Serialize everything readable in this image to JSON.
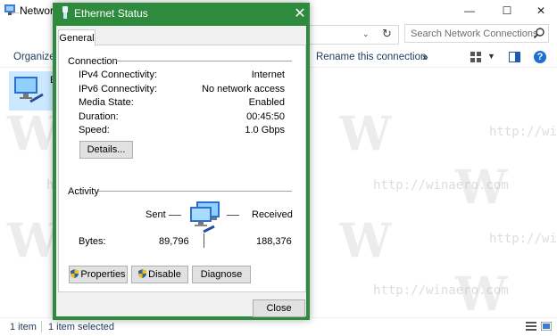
{
  "background_window": {
    "title": "Network",
    "search_placeholder": "Search Network Connections",
    "commands": {
      "organize": "Organize",
      "rename": "Rename this connection",
      "more": "»"
    },
    "item_label": "E",
    "status": {
      "count": "1 item",
      "selected": "1 item selected"
    },
    "watermark_text": "http://winaero.com",
    "caption_buttons": {
      "minimize": "—",
      "maximize": "☐",
      "close": "✕"
    },
    "help": "?"
  },
  "dialog": {
    "title": "Ethernet Status",
    "close_glyph": "✕",
    "tab": "General",
    "connection": {
      "heading": "Connection",
      "rows": [
        {
          "label": "IPv4 Connectivity:",
          "value": "Internet"
        },
        {
          "label": "IPv6 Connectivity:",
          "value": "No network access"
        },
        {
          "label": "Media State:",
          "value": "Enabled"
        },
        {
          "label": "Duration:",
          "value": "00:45:50"
        },
        {
          "label": "Speed:",
          "value": "1.0 Gbps"
        }
      ],
      "details_button": "Details..."
    },
    "activity": {
      "heading": "Activity",
      "sent_label": "Sent",
      "received_label": "Received",
      "bytes_label": "Bytes:",
      "bytes_sent": "89,796",
      "bytes_received": "188,376"
    },
    "buttons": {
      "properties": "Properties",
      "disable": "Disable",
      "diagnose": "Diagnose",
      "close": "Close"
    },
    "colors": {
      "accent": "#2e8b3e",
      "body": "#f0f0f0"
    }
  }
}
